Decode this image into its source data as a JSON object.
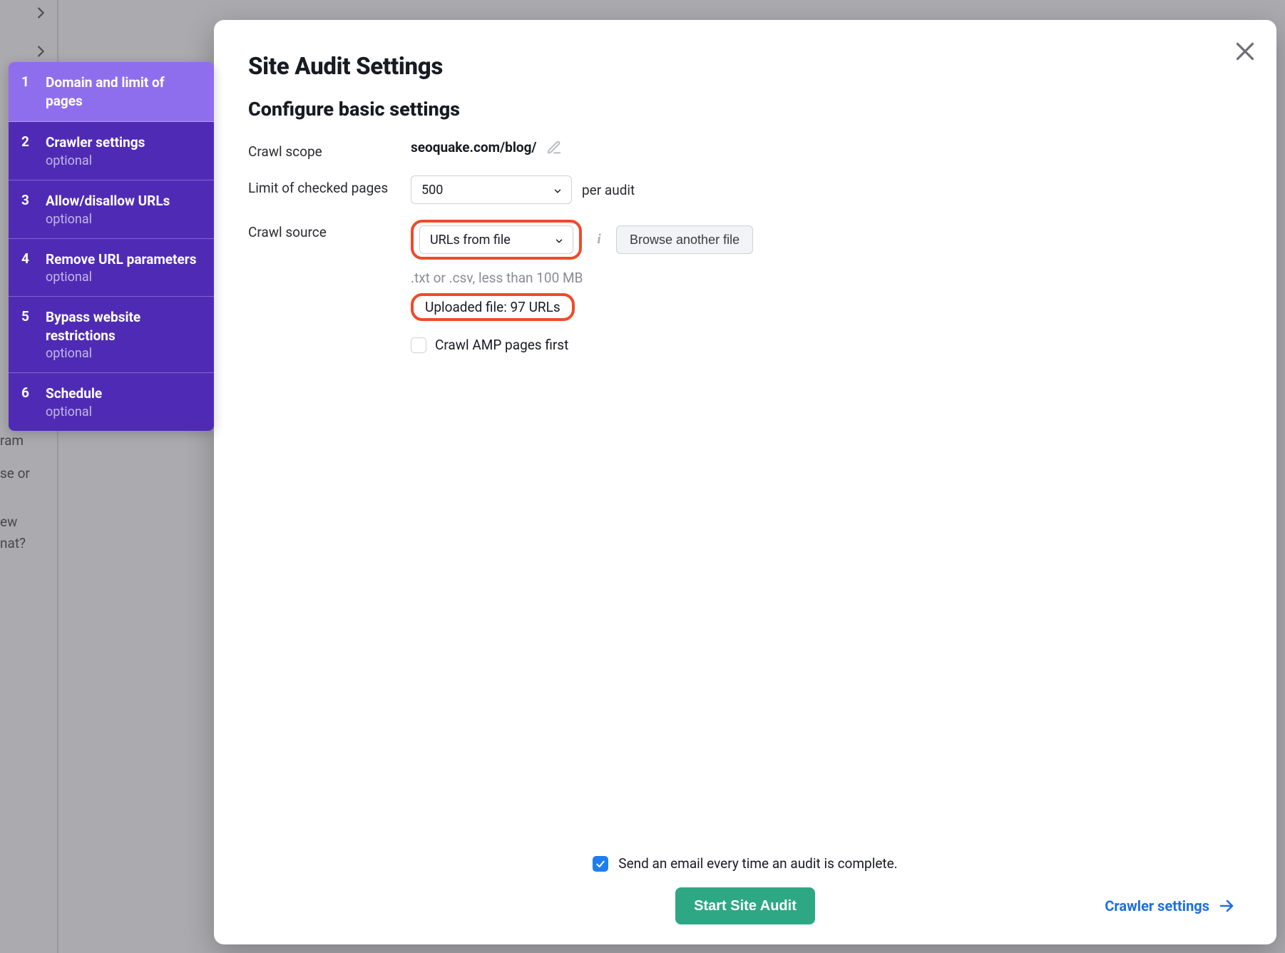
{
  "sidebar": {
    "steps": [
      {
        "num": "1",
        "title": "Domain and limit of pages",
        "subtitle": ""
      },
      {
        "num": "2",
        "title": "Crawler settings",
        "subtitle": "optional"
      },
      {
        "num": "3",
        "title": "Allow/disallow URLs",
        "subtitle": "optional"
      },
      {
        "num": "4",
        "title": "Remove URL parameters",
        "subtitle": "optional"
      },
      {
        "num": "5",
        "title": "Bypass website restrictions",
        "subtitle": "optional"
      },
      {
        "num": "6",
        "title": "Schedule",
        "subtitle": "optional"
      }
    ]
  },
  "modal": {
    "title": "Site Audit Settings",
    "section_title": "Configure basic settings",
    "labels": {
      "crawl_scope": "Crawl scope",
      "limit_pages": "Limit of checked pages",
      "crawl_source": "Crawl source"
    },
    "crawl_scope_value": "seoquake.com/blog/",
    "limit_pages_value": "500",
    "per_audit": "per audit",
    "crawl_source_value": "URLs from file",
    "browse_button": "Browse another file",
    "file_hint": ".txt or .csv, less than 100 MB",
    "uploaded_file": "Uploaded file: 97 URLs",
    "amp_label": "Crawl AMP pages first",
    "email_label": "Send an email every time an audit is complete.",
    "start_button": "Start Site Audit",
    "next_link": "Crawler settings"
  },
  "bg": {
    "t1": "ram",
    "t2": "se or",
    "t3": "ew",
    "t4": "nat?"
  }
}
